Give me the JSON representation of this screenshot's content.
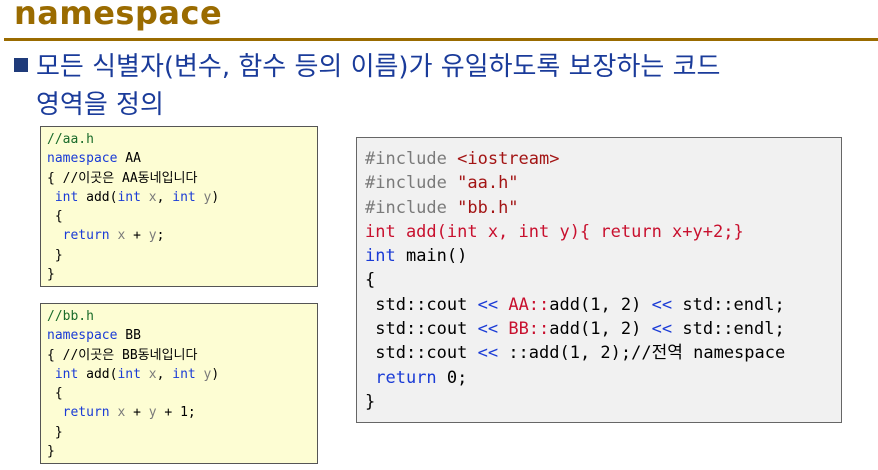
{
  "slide": {
    "title": "namespace",
    "bullet_line1": "모든 식별자(변수, 함수 등의 이름)가 유일하도록 보장하는 코드",
    "bullet_line2": "영역을 정의"
  },
  "code_aa": [
    [
      {
        "t": "//aa.h",
        "c": "cm"
      }
    ],
    [
      {
        "t": "namespace",
        "c": "kw"
      },
      {
        "t": " AA",
        "c": "blk"
      }
    ],
    [
      {
        "t": "{ //이곳은 AA동네입니다",
        "c": "blk"
      }
    ],
    [
      {
        "t": " ",
        "c": "blk"
      },
      {
        "t": "int",
        "c": "kw"
      },
      {
        "t": " add(",
        "c": "blk"
      },
      {
        "t": "int",
        "c": "kw"
      },
      {
        "t": " x",
        "c": "id"
      },
      {
        "t": ", ",
        "c": "blk"
      },
      {
        "t": "int",
        "c": "kw"
      },
      {
        "t": " y",
        "c": "id"
      },
      {
        "t": ")",
        "c": "blk"
      }
    ],
    [
      {
        "t": " {",
        "c": "blk"
      }
    ],
    [
      {
        "t": "  ",
        "c": "blk"
      },
      {
        "t": "return",
        "c": "kw"
      },
      {
        "t": " x",
        "c": "id"
      },
      {
        "t": " + ",
        "c": "blk"
      },
      {
        "t": "y",
        "c": "id"
      },
      {
        "t": ";",
        "c": "blk"
      }
    ],
    [
      {
        "t": " }",
        "c": "blk"
      }
    ],
    [
      {
        "t": "}",
        "c": "blk"
      }
    ]
  ],
  "code_bb": [
    [
      {
        "t": "//bb.h",
        "c": "cm"
      }
    ],
    [
      {
        "t": "namespace",
        "c": "kw"
      },
      {
        "t": " BB",
        "c": "blk"
      }
    ],
    [
      {
        "t": "{ //이곳은 BB동네입니다",
        "c": "blk"
      }
    ],
    [
      {
        "t": " ",
        "c": "blk"
      },
      {
        "t": "int",
        "c": "kw"
      },
      {
        "t": " add(",
        "c": "blk"
      },
      {
        "t": "int",
        "c": "kw"
      },
      {
        "t": " x",
        "c": "id"
      },
      {
        "t": ", ",
        "c": "blk"
      },
      {
        "t": "int",
        "c": "kw"
      },
      {
        "t": " y",
        "c": "id"
      },
      {
        "t": ")",
        "c": "blk"
      }
    ],
    [
      {
        "t": " {",
        "c": "blk"
      }
    ],
    [
      {
        "t": "  ",
        "c": "blk"
      },
      {
        "t": "return",
        "c": "kw"
      },
      {
        "t": " x",
        "c": "id"
      },
      {
        "t": " + ",
        "c": "blk"
      },
      {
        "t": "y",
        "c": "id"
      },
      {
        "t": " + 1;",
        "c": "blk"
      }
    ],
    [
      {
        "t": " }",
        "c": "blk"
      }
    ],
    [
      {
        "t": "}",
        "c": "blk"
      }
    ]
  ],
  "code_main": [
    [
      {
        "t": "#include ",
        "c": "pp"
      },
      {
        "t": "<iostream>",
        "c": "str"
      }
    ],
    [
      {
        "t": "#include ",
        "c": "pp"
      },
      {
        "t": "\"aa.h\"",
        "c": "str"
      }
    ],
    [
      {
        "t": "#include ",
        "c": "pp"
      },
      {
        "t": "\"bb.h\"",
        "c": "str"
      }
    ],
    [
      {
        "t": "int add(int x, int y){ return x+y+2;}",
        "c": "red"
      }
    ],
    [
      {
        "t": "int",
        "c": "kw"
      },
      {
        "t": " main()",
        "c": "blk"
      }
    ],
    [
      {
        "t": "{",
        "c": "blk"
      }
    ],
    [
      {
        "t": " std::cout ",
        "c": "blk"
      },
      {
        "t": "<<",
        "c": "op"
      },
      {
        "t": " ",
        "c": "blk"
      },
      {
        "t": "AA::",
        "c": "red"
      },
      {
        "t": "add(1, 2) ",
        "c": "blk"
      },
      {
        "t": "<<",
        "c": "op"
      },
      {
        "t": " std::endl;",
        "c": "blk"
      }
    ],
    [
      {
        "t": " std::cout ",
        "c": "blk"
      },
      {
        "t": "<<",
        "c": "op"
      },
      {
        "t": " ",
        "c": "blk"
      },
      {
        "t": "BB::",
        "c": "red"
      },
      {
        "t": "add(1, 2) ",
        "c": "blk"
      },
      {
        "t": "<<",
        "c": "op"
      },
      {
        "t": " std::endl;",
        "c": "blk"
      }
    ],
    [
      {
        "t": " std::cout ",
        "c": "blk"
      },
      {
        "t": "<<",
        "c": "op"
      },
      {
        "t": " ::add(1, 2);//전역 namespace",
        "c": "blk"
      }
    ],
    [
      {
        "t": " ",
        "c": "blk"
      },
      {
        "t": "return",
        "c": "kw"
      },
      {
        "t": " 0;",
        "c": "blk"
      }
    ],
    [
      {
        "t": "}",
        "c": "blk"
      }
    ]
  ]
}
